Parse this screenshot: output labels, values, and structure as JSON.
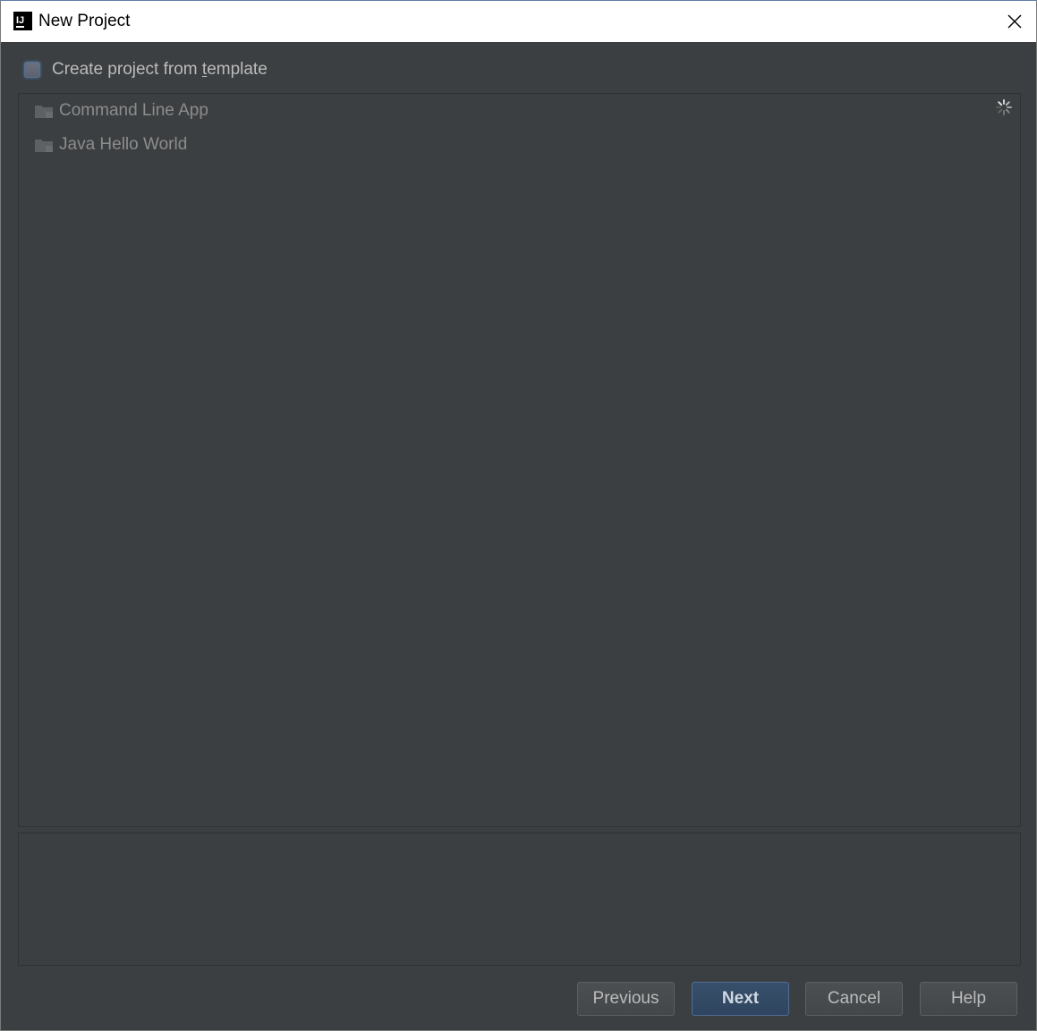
{
  "window": {
    "title": "New Project",
    "app_icon_text": "IJ"
  },
  "template": {
    "checkbox_label_prefix": "Create project from ",
    "checkbox_label_mnemonic": "t",
    "checkbox_label_suffix": "emplate",
    "checked": false
  },
  "templates_list": {
    "items": [
      {
        "label": "Command Line App",
        "icon": "folder-icon"
      },
      {
        "label": "Java Hello World",
        "icon": "folder-icon"
      }
    ],
    "loading_icon": "spinner-icon"
  },
  "description": {
    "text": ""
  },
  "buttons": {
    "previous": "Previous",
    "next": "Next",
    "cancel": "Cancel",
    "help": "Help"
  },
  "colors": {
    "background": "#3c3f41",
    "text": "#bbbbbb",
    "disabled_text": "#8c8c8c",
    "accent": "#365880"
  }
}
